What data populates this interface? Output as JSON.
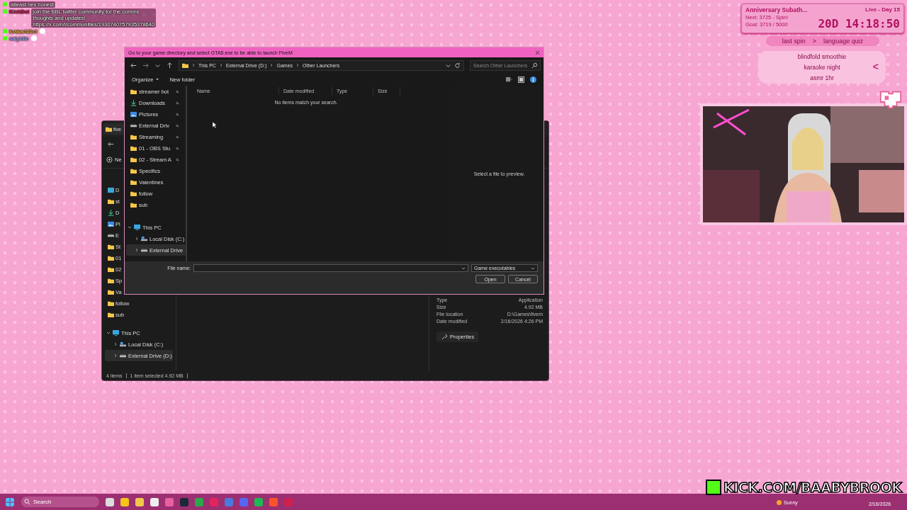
{
  "chat": [
    {
      "message": "atleast hes honest"
    },
    {
      "user": "KickBot",
      "color": "#e0245e",
      "message": "join the BBL twitter community for the comms thoughts and updates! https://x.com/i/communities/1930740757935378640"
    },
    {
      "user": "krakadd1ct",
      "color": "#f0b040"
    },
    {
      "user": "saiyidic",
      "color": "#b0b8ff"
    }
  ],
  "subathon": {
    "title": "Anniversary Subath...",
    "next": "Next: 3725 - Spin!",
    "goal": "Goal: 3719 / 5000",
    "day": "Live - Day 15",
    "timer": "20D 14:18:50",
    "last_spin_label": "last spin",
    "last_spin_arrow": ">",
    "last_spin_value": "language quiz",
    "wheel": [
      "blindfold smoothie",
      "karaoke night",
      "asmr 1hr"
    ],
    "wheel_arrow": "<"
  },
  "back_window": {
    "tab_title": "five",
    "new_button": "Ne",
    "nav_items": [
      {
        "kind": "desktop",
        "label": "D"
      },
      {
        "kind": "folder",
        "label": "st"
      },
      {
        "kind": "download",
        "label": "D"
      },
      {
        "kind": "pictures",
        "label": "Pi"
      },
      {
        "kind": "drive",
        "label": "E"
      },
      {
        "kind": "folder",
        "label": "St"
      },
      {
        "kind": "folder",
        "label": "01"
      },
      {
        "kind": "folder",
        "label": "02"
      },
      {
        "kind": "folder",
        "label": "Sp"
      },
      {
        "kind": "folder",
        "label": "Va"
      },
      {
        "kind": "folder",
        "label": "follow"
      },
      {
        "kind": "folder",
        "label": "sub"
      }
    ],
    "tree": [
      {
        "label": "This PC",
        "kind": "pc",
        "expanded": true,
        "selected": false,
        "children": [
          {
            "label": "Local Disk (C:)",
            "kind": "disk",
            "expanded": false,
            "selected": false
          },
          {
            "label": "External Drive (D:)",
            "kind": "drive",
            "expanded": false,
            "selected": true
          }
        ]
      }
    ],
    "details": [
      {
        "label": "Type",
        "value": "Application"
      },
      {
        "label": "Size",
        "value": "4.92 MB"
      },
      {
        "label": "File location",
        "value": "D:\\Games\\fivem"
      },
      {
        "label": "Date modified",
        "value": "2/16/2026 4:26 PM"
      }
    ],
    "properties_button": "Properties",
    "status": [
      "4 items",
      "1 item selected  4.92 MB"
    ]
  },
  "dialog": {
    "title": "Go to your game directory and select GTA5.exe to be able to launch FiveM",
    "breadcrumb": [
      "This PC",
      "External Drive (D:)",
      "Games",
      "Other Launchers"
    ],
    "search": {
      "placeholder": "Search Other Launchers"
    },
    "organize": "Organize",
    "new_folder": "New folder",
    "nav_items": [
      {
        "label": "streamer bot",
        "kind": "folder",
        "pinned": true
      },
      {
        "label": "Downloads",
        "kind": "download",
        "pinned": true
      },
      {
        "label": "Pictures",
        "kind": "pictures",
        "pinned": true
      },
      {
        "label": "External Driv",
        "kind": "drive",
        "pinned": true
      },
      {
        "label": "Streaming",
        "kind": "folder",
        "pinned": true
      },
      {
        "label": "01 - OBS Stu",
        "kind": "folder",
        "pinned": true
      },
      {
        "label": "02 - Stream A",
        "kind": "folder",
        "pinned": true
      },
      {
        "label": "Specifics",
        "kind": "folder",
        "pinned": false
      },
      {
        "label": "Valentines",
        "kind": "folder",
        "pinned": false
      },
      {
        "label": "follow",
        "kind": "folder",
        "pinned": false
      },
      {
        "label": "sub",
        "kind": "folder",
        "pinned": false
      }
    ],
    "tree": [
      {
        "label": "This PC",
        "kind": "pc",
        "expanded": true,
        "selected": false,
        "children": [
          {
            "label": "Local Disk (C:)",
            "kind": "disk",
            "expanded": false,
            "selected": false
          },
          {
            "label": "External Drive",
            "kind": "drive",
            "expanded": false,
            "selected": true
          }
        ]
      }
    ],
    "columns": [
      "Name",
      "Date modified",
      "Type",
      "Size"
    ],
    "empty_message": "No items match your search.",
    "preview_message": "Select a file to preview.",
    "file_name_label": "File name:",
    "file_type": "Game executables",
    "buttons": [
      "Open",
      "Cancel"
    ]
  },
  "taskbar": {
    "search": {
      "placeholder": "Search"
    },
    "weather": "Sunny",
    "date": "2/16/2026"
  },
  "banner": {
    "text": "KICK.COM/BAABYBROOK"
  }
}
